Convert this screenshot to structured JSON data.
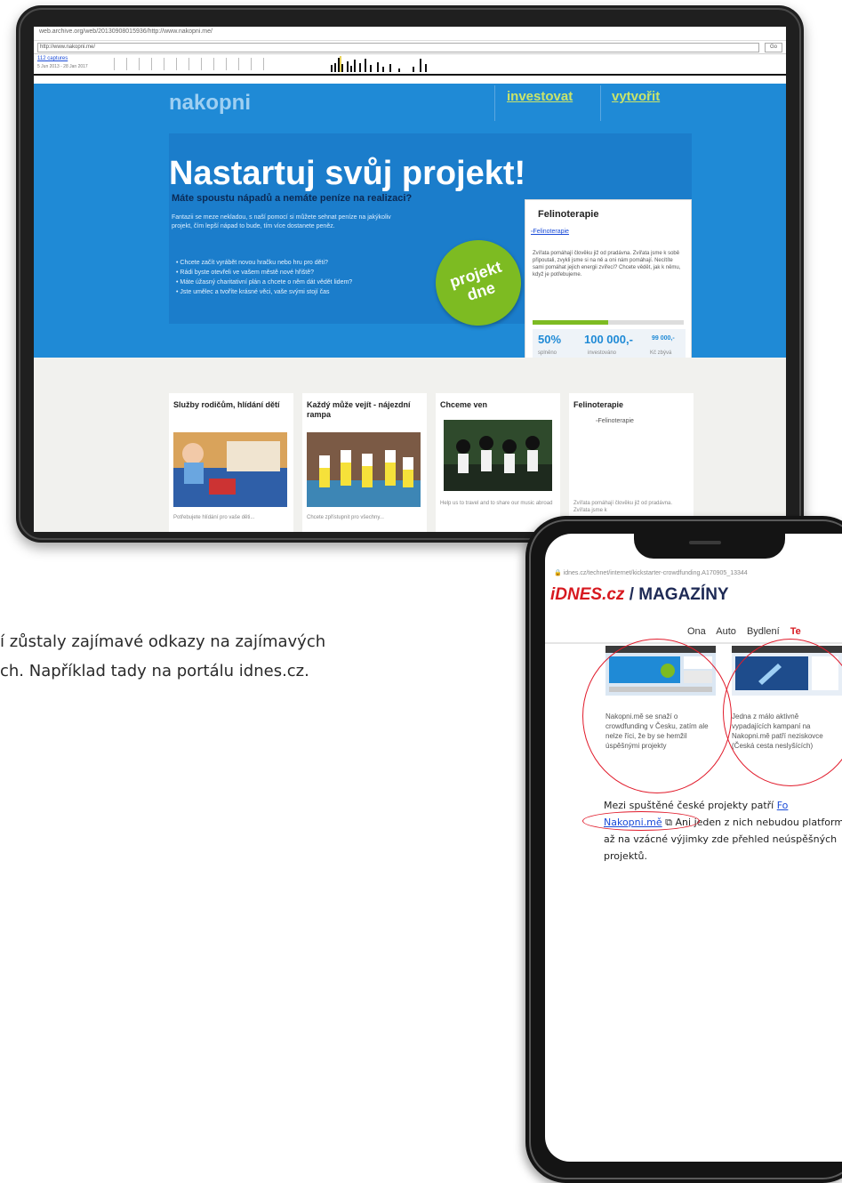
{
  "tablet": {
    "wayback_url": "web.archive.org/web/20130908015936/http://www.nakopni.me/",
    "address": "http://www.nakopni.me/",
    "go": "Go",
    "captures": "112 captures",
    "capture_dates": "5 Jun 2013 - 28 Jan 2017",
    "logo": "nakopni",
    "nav": [
      "investovat",
      "vytvořit"
    ],
    "headline": "Nastartuj svůj projekt!",
    "subheadline": "Máte spoustu nápadů a nemáte peníze na realizaci?",
    "intro": "Fantazii se meze nekladou, s naší pomocí si můžete sehnat peníze na jakýkoliv projekt, čím lepší nápad to bude, tím více dostanete peněz.",
    "bullets": [
      "Chcete začít vyrábět novou hračku nebo hru pro děti?",
      "Rádi byste otevřeli ve vašem městě nové hřiště?",
      "Máte úžasný charitativní plán a chcete o něm dát vědět lidem?",
      "Jste umělec a tvoříte krásné věci, vaše svými stojí čas"
    ],
    "badge": [
      "projekt",
      "dne"
    ],
    "featured": {
      "title": "Felinoterapie",
      "image_alt": "Felinoterapie",
      "description": "Zvířata pomáhají člověku již od pradávna. Zvířata jsme k sobě připoutali, zvykli jsme si na ně a oni nám pomáhají. Necítíte sami pomáhat jejich energii zvířecí? Chcete vědět, jak k němu, když je potřebujeme.",
      "progress": 0.5,
      "percent": "50%",
      "invested": "100 000,-",
      "remaining": "99 000,-",
      "labels": [
        "splněno",
        "investováno",
        "Kč zbývá"
      ]
    },
    "tiles": [
      {
        "title": "Služby rodičům, hlídání dětí",
        "snippet": "Potřebujete hlídání pro vaše děti..."
      },
      {
        "title": "Každý může vejít - nájezdní rampa",
        "snippet": "Chcete zpřístupnit pro všechny..."
      },
      {
        "title": "Chceme ven",
        "snippet": "Help us to travel and to share our music abroad"
      },
      {
        "title": "Felinoterapie",
        "image_alt": "Felinoterapie",
        "snippet": "Zvířata pomáhají člověku již od pradávna. Zvířata jsme k"
      }
    ]
  },
  "caption": {
    "line1": "í zůstaly zajímavé odkazy na zajímavých",
    "line2": "ch. Například tady na portálu idnes.cz."
  },
  "phone": {
    "url": "idnes.cz/technet/internet/kickstarter-crowdfunding.A170905_13344",
    "brand": "iDNES.cz",
    "brand_suffix": " / MAGAZÍNY",
    "nav": [
      "Ona",
      "Auto",
      "Bydlení",
      "Te"
    ],
    "captions": [
      "Nakopni.mě se snaží o crowdfunding v Česku, zatím ale nelze říci, že by se hemžil úspěšnými projekty",
      "Jedna z málo aktivně vypadajících kampaní na Nakopni.mě patří neziskovce (Česká cesta neslyšících)"
    ],
    "paragraph_before": "Mezi spuštěné české projekty patří ",
    "paragraph_link1": "Fo",
    "paragraph_link2": "Nakopni.mě",
    "paragraph_after": " Ani jeden z nich nebudou platformy a až na vzácné výjimky zde přehled neúspěšných projektů."
  },
  "colors": {
    "hero_blue": "#1f8ad6",
    "accent_green": "#7dbb22",
    "idnes_red": "#d71920",
    "annotation_red": "#e11b2b"
  }
}
